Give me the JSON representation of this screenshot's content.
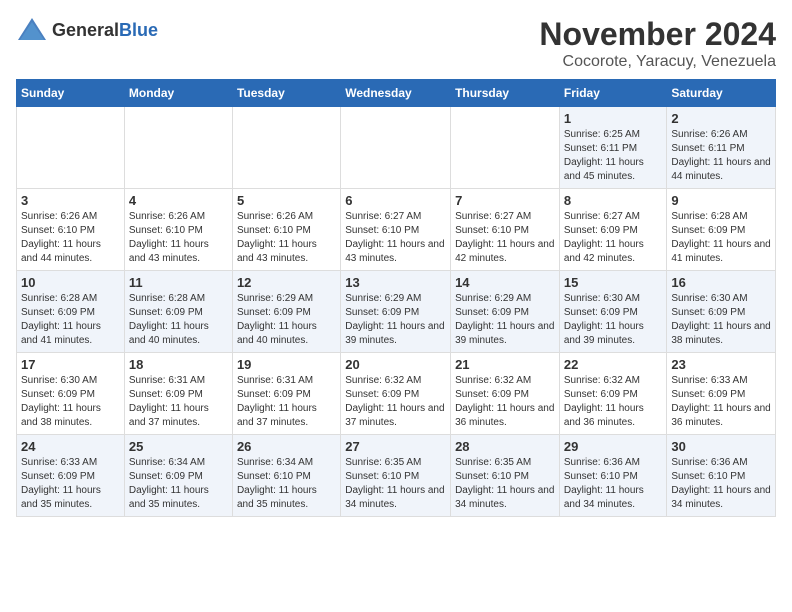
{
  "logo": {
    "general": "General",
    "blue": "Blue"
  },
  "title": "November 2024",
  "subtitle": "Cocorote, Yaracuy, Venezuela",
  "days_of_week": [
    "Sunday",
    "Monday",
    "Tuesday",
    "Wednesday",
    "Thursday",
    "Friday",
    "Saturday"
  ],
  "weeks": [
    [
      {
        "day": "",
        "content": ""
      },
      {
        "day": "",
        "content": ""
      },
      {
        "day": "",
        "content": ""
      },
      {
        "day": "",
        "content": ""
      },
      {
        "day": "",
        "content": ""
      },
      {
        "day": "1",
        "content": "Sunrise: 6:25 AM\nSunset: 6:11 PM\nDaylight: 11 hours and 45 minutes."
      },
      {
        "day": "2",
        "content": "Sunrise: 6:26 AM\nSunset: 6:11 PM\nDaylight: 11 hours and 44 minutes."
      }
    ],
    [
      {
        "day": "3",
        "content": "Sunrise: 6:26 AM\nSunset: 6:10 PM\nDaylight: 11 hours and 44 minutes."
      },
      {
        "day": "4",
        "content": "Sunrise: 6:26 AM\nSunset: 6:10 PM\nDaylight: 11 hours and 43 minutes."
      },
      {
        "day": "5",
        "content": "Sunrise: 6:26 AM\nSunset: 6:10 PM\nDaylight: 11 hours and 43 minutes."
      },
      {
        "day": "6",
        "content": "Sunrise: 6:27 AM\nSunset: 6:10 PM\nDaylight: 11 hours and 43 minutes."
      },
      {
        "day": "7",
        "content": "Sunrise: 6:27 AM\nSunset: 6:10 PM\nDaylight: 11 hours and 42 minutes."
      },
      {
        "day": "8",
        "content": "Sunrise: 6:27 AM\nSunset: 6:09 PM\nDaylight: 11 hours and 42 minutes."
      },
      {
        "day": "9",
        "content": "Sunrise: 6:28 AM\nSunset: 6:09 PM\nDaylight: 11 hours and 41 minutes."
      }
    ],
    [
      {
        "day": "10",
        "content": "Sunrise: 6:28 AM\nSunset: 6:09 PM\nDaylight: 11 hours and 41 minutes."
      },
      {
        "day": "11",
        "content": "Sunrise: 6:28 AM\nSunset: 6:09 PM\nDaylight: 11 hours and 40 minutes."
      },
      {
        "day": "12",
        "content": "Sunrise: 6:29 AM\nSunset: 6:09 PM\nDaylight: 11 hours and 40 minutes."
      },
      {
        "day": "13",
        "content": "Sunrise: 6:29 AM\nSunset: 6:09 PM\nDaylight: 11 hours and 39 minutes."
      },
      {
        "day": "14",
        "content": "Sunrise: 6:29 AM\nSunset: 6:09 PM\nDaylight: 11 hours and 39 minutes."
      },
      {
        "day": "15",
        "content": "Sunrise: 6:30 AM\nSunset: 6:09 PM\nDaylight: 11 hours and 39 minutes."
      },
      {
        "day": "16",
        "content": "Sunrise: 6:30 AM\nSunset: 6:09 PM\nDaylight: 11 hours and 38 minutes."
      }
    ],
    [
      {
        "day": "17",
        "content": "Sunrise: 6:30 AM\nSunset: 6:09 PM\nDaylight: 11 hours and 38 minutes."
      },
      {
        "day": "18",
        "content": "Sunrise: 6:31 AM\nSunset: 6:09 PM\nDaylight: 11 hours and 37 minutes."
      },
      {
        "day": "19",
        "content": "Sunrise: 6:31 AM\nSunset: 6:09 PM\nDaylight: 11 hours and 37 minutes."
      },
      {
        "day": "20",
        "content": "Sunrise: 6:32 AM\nSunset: 6:09 PM\nDaylight: 11 hours and 37 minutes."
      },
      {
        "day": "21",
        "content": "Sunrise: 6:32 AM\nSunset: 6:09 PM\nDaylight: 11 hours and 36 minutes."
      },
      {
        "day": "22",
        "content": "Sunrise: 6:32 AM\nSunset: 6:09 PM\nDaylight: 11 hours and 36 minutes."
      },
      {
        "day": "23",
        "content": "Sunrise: 6:33 AM\nSunset: 6:09 PM\nDaylight: 11 hours and 36 minutes."
      }
    ],
    [
      {
        "day": "24",
        "content": "Sunrise: 6:33 AM\nSunset: 6:09 PM\nDaylight: 11 hours and 35 minutes."
      },
      {
        "day": "25",
        "content": "Sunrise: 6:34 AM\nSunset: 6:09 PM\nDaylight: 11 hours and 35 minutes."
      },
      {
        "day": "26",
        "content": "Sunrise: 6:34 AM\nSunset: 6:10 PM\nDaylight: 11 hours and 35 minutes."
      },
      {
        "day": "27",
        "content": "Sunrise: 6:35 AM\nSunset: 6:10 PM\nDaylight: 11 hours and 34 minutes."
      },
      {
        "day": "28",
        "content": "Sunrise: 6:35 AM\nSunset: 6:10 PM\nDaylight: 11 hours and 34 minutes."
      },
      {
        "day": "29",
        "content": "Sunrise: 6:36 AM\nSunset: 6:10 PM\nDaylight: 11 hours and 34 minutes."
      },
      {
        "day": "30",
        "content": "Sunrise: 6:36 AM\nSunset: 6:10 PM\nDaylight: 11 hours and 34 minutes."
      }
    ]
  ]
}
